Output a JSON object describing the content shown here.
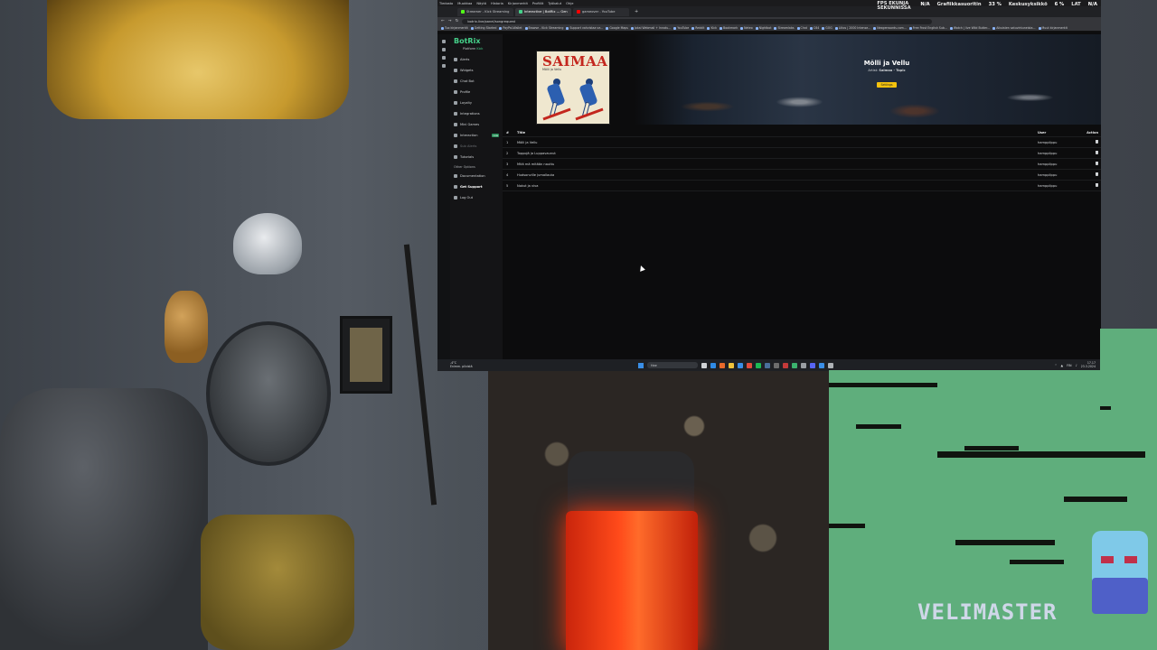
{
  "browser": {
    "menu": [
      "Tiedosto",
      "Muokkaa",
      "Näytä",
      "Historia",
      "Kirjanmerkit",
      "Profiilit",
      "Työkalut",
      "Ohje"
    ],
    "tabs": [
      {
        "label": "Streamer - Kick Streaming",
        "color": "#53fc18",
        "active": false
      },
      {
        "label": "Interactive | BotRix — Gen",
        "color": "#45d18a",
        "active": true
      },
      {
        "label": "gameover - YouTube",
        "color": "#ff0000",
        "active": false
      }
    ],
    "address": "botrix.live/panel/songrequest",
    "bookmarks": [
      "Tuo kirjanmerkit",
      "Getting Started",
      "PayPal-Wallet",
      "Browse - Kick Streaming",
      "Support vahvistaa ve...",
      "Google Maps",
      "Jokai Webmail + Innatu...",
      "YouTube",
      "Reddit",
      "Kick",
      "Bookmark",
      "Neteo",
      "Nightbot",
      "Streamlabs",
      "Chat",
      "C64",
      "GOG",
      "Liitos | 2000 Intense...",
      "Nexgenwords.com...",
      "Free Frost English Sub...",
      "Watch | live Wild Butter...",
      "Aikuisten satuvintuneista...",
      "Muut kirjanmerkit"
    ]
  },
  "overlay": {
    "fps_label": "FPS EKUNJA SEKUNNISSA",
    "fps_value": "N/A",
    "gpu_label": "Grafiikkasuoritin",
    "gpu_value": "33 %",
    "cpu_label": "Keskusyksikkö",
    "cpu_value": "6 %",
    "lat_label": "LAT",
    "lat_value": "N/A"
  },
  "sidebar": {
    "logo": "BotRix",
    "plan_label": "Platform",
    "plan_value": "Kick",
    "items": [
      {
        "label": "Alerts",
        "dim": false
      },
      {
        "label": "Widgets",
        "dim": false
      },
      {
        "label": "Chat Bot",
        "dim": false
      },
      {
        "label": "Profile",
        "dim": false
      },
      {
        "label": "Loyalty",
        "dim": false
      },
      {
        "label": "Integrations",
        "dim": false
      },
      {
        "label": "Mini Games",
        "dim": false
      },
      {
        "label": "Interaction",
        "dim": false,
        "badge": "new"
      },
      {
        "label": "Sub Alerts",
        "dim": true
      },
      {
        "label": "Tutorials",
        "dim": false
      }
    ],
    "other_label": "Other Options",
    "other_items": [
      {
        "label": "Documentation"
      },
      {
        "label": "Get Support"
      },
      {
        "label": "Log Out"
      }
    ]
  },
  "now_playing": {
    "cover_title": "SAIMAA",
    "cover_sub": "Mölli ja Vellu",
    "title": "Mölli ja Vellu",
    "artist_label": "Artist:",
    "artist": "Saimaa - Topic",
    "button": "Settings"
  },
  "queue": {
    "headers": {
      "num": "#",
      "title": "Title",
      "user": "User",
      "action": "Action"
    },
    "rows": [
      {
        "num": "1",
        "title": "Mölli ja Vellu",
        "user": "hamppilppu"
      },
      {
        "num": "2",
        "title": "Toppojä ja Luppavaunut",
        "user": "hamppilppu"
      },
      {
        "num": "3",
        "title": "Mitä mä mitään nauttu",
        "user": "hamppilppu"
      },
      {
        "num": "4",
        "title": "Hudsonville jumallauta",
        "user": "hamppilppu"
      },
      {
        "num": "5",
        "title": "Nokut ja viva",
        "user": "hamppilppu"
      }
    ]
  },
  "taskbar": {
    "weather_temp": "-4°C",
    "weather_desc": "Enimm. pilvistä",
    "search": "Hae",
    "lang": "FIN",
    "time": "17.17",
    "date": "23.3.2024"
  },
  "stream": {
    "watermark": "VELIMASTER"
  }
}
